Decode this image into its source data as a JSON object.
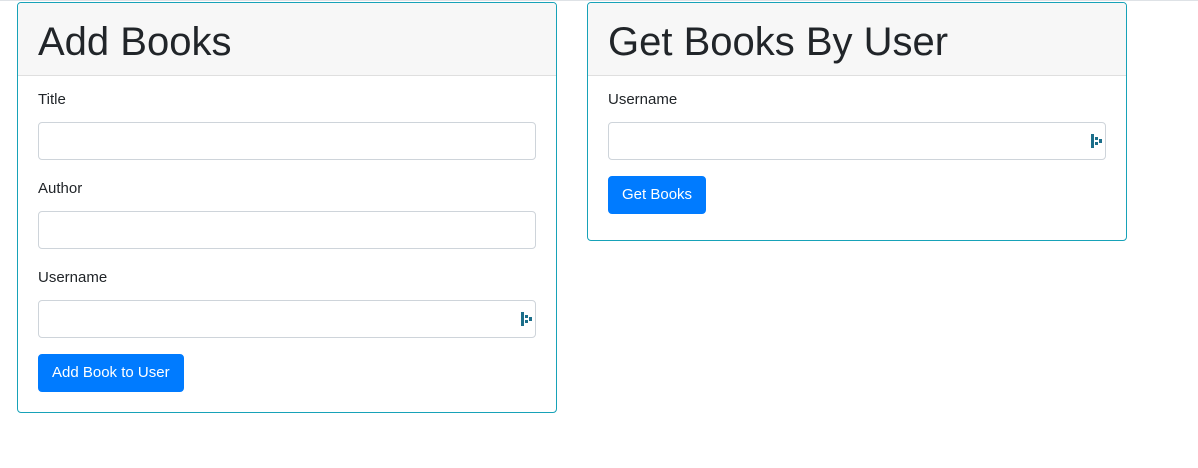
{
  "add_books": {
    "title": "Add Books",
    "fields": {
      "title_label": "Title",
      "title_value": "",
      "author_label": "Author",
      "author_value": "",
      "username_label": "Username",
      "username_value": ""
    },
    "submit_label": "Add Book to User"
  },
  "get_books": {
    "title": "Get Books By User",
    "fields": {
      "username_label": "Username",
      "username_value": ""
    },
    "submit_label": "Get Books"
  },
  "colors": {
    "card_border": "#17a2b8",
    "primary_button": "#007bff",
    "header_bg": "#f7f7f7"
  },
  "icons": {
    "username_field_extension": "password-manager-icon"
  }
}
